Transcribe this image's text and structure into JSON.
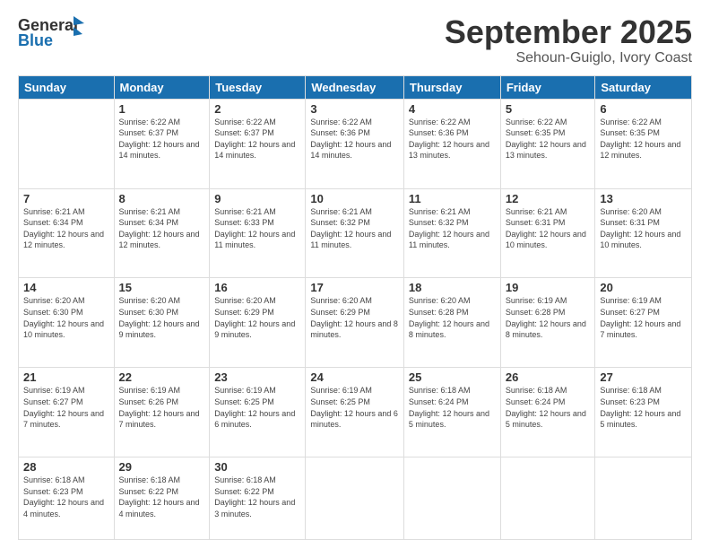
{
  "header": {
    "logo_general": "General",
    "logo_blue": "Blue",
    "month": "September 2025",
    "location": "Sehoun-Guiglo, Ivory Coast"
  },
  "columns": [
    "Sunday",
    "Monday",
    "Tuesday",
    "Wednesday",
    "Thursday",
    "Friday",
    "Saturday"
  ],
  "weeks": [
    [
      {
        "day": "",
        "sunrise": "",
        "sunset": "",
        "daylight": ""
      },
      {
        "day": "1",
        "sunrise": "Sunrise: 6:22 AM",
        "sunset": "Sunset: 6:37 PM",
        "daylight": "Daylight: 12 hours and 14 minutes."
      },
      {
        "day": "2",
        "sunrise": "Sunrise: 6:22 AM",
        "sunset": "Sunset: 6:37 PM",
        "daylight": "Daylight: 12 hours and 14 minutes."
      },
      {
        "day": "3",
        "sunrise": "Sunrise: 6:22 AM",
        "sunset": "Sunset: 6:36 PM",
        "daylight": "Daylight: 12 hours and 14 minutes."
      },
      {
        "day": "4",
        "sunrise": "Sunrise: 6:22 AM",
        "sunset": "Sunset: 6:36 PM",
        "daylight": "Daylight: 12 hours and 13 minutes."
      },
      {
        "day": "5",
        "sunrise": "Sunrise: 6:22 AM",
        "sunset": "Sunset: 6:35 PM",
        "daylight": "Daylight: 12 hours and 13 minutes."
      },
      {
        "day": "6",
        "sunrise": "Sunrise: 6:22 AM",
        "sunset": "Sunset: 6:35 PM",
        "daylight": "Daylight: 12 hours and 12 minutes."
      }
    ],
    [
      {
        "day": "7",
        "sunrise": "Sunrise: 6:21 AM",
        "sunset": "Sunset: 6:34 PM",
        "daylight": "Daylight: 12 hours and 12 minutes."
      },
      {
        "day": "8",
        "sunrise": "Sunrise: 6:21 AM",
        "sunset": "Sunset: 6:34 PM",
        "daylight": "Daylight: 12 hours and 12 minutes."
      },
      {
        "day": "9",
        "sunrise": "Sunrise: 6:21 AM",
        "sunset": "Sunset: 6:33 PM",
        "daylight": "Daylight: 12 hours and 11 minutes."
      },
      {
        "day": "10",
        "sunrise": "Sunrise: 6:21 AM",
        "sunset": "Sunset: 6:32 PM",
        "daylight": "Daylight: 12 hours and 11 minutes."
      },
      {
        "day": "11",
        "sunrise": "Sunrise: 6:21 AM",
        "sunset": "Sunset: 6:32 PM",
        "daylight": "Daylight: 12 hours and 11 minutes."
      },
      {
        "day": "12",
        "sunrise": "Sunrise: 6:21 AM",
        "sunset": "Sunset: 6:31 PM",
        "daylight": "Daylight: 12 hours and 10 minutes."
      },
      {
        "day": "13",
        "sunrise": "Sunrise: 6:20 AM",
        "sunset": "Sunset: 6:31 PM",
        "daylight": "Daylight: 12 hours and 10 minutes."
      }
    ],
    [
      {
        "day": "14",
        "sunrise": "Sunrise: 6:20 AM",
        "sunset": "Sunset: 6:30 PM",
        "daylight": "Daylight: 12 hours and 10 minutes."
      },
      {
        "day": "15",
        "sunrise": "Sunrise: 6:20 AM",
        "sunset": "Sunset: 6:30 PM",
        "daylight": "Daylight: 12 hours and 9 minutes."
      },
      {
        "day": "16",
        "sunrise": "Sunrise: 6:20 AM",
        "sunset": "Sunset: 6:29 PM",
        "daylight": "Daylight: 12 hours and 9 minutes."
      },
      {
        "day": "17",
        "sunrise": "Sunrise: 6:20 AM",
        "sunset": "Sunset: 6:29 PM",
        "daylight": "Daylight: 12 hours and 8 minutes."
      },
      {
        "day": "18",
        "sunrise": "Sunrise: 6:20 AM",
        "sunset": "Sunset: 6:28 PM",
        "daylight": "Daylight: 12 hours and 8 minutes."
      },
      {
        "day": "19",
        "sunrise": "Sunrise: 6:19 AM",
        "sunset": "Sunset: 6:28 PM",
        "daylight": "Daylight: 12 hours and 8 minutes."
      },
      {
        "day": "20",
        "sunrise": "Sunrise: 6:19 AM",
        "sunset": "Sunset: 6:27 PM",
        "daylight": "Daylight: 12 hours and 7 minutes."
      }
    ],
    [
      {
        "day": "21",
        "sunrise": "Sunrise: 6:19 AM",
        "sunset": "Sunset: 6:27 PM",
        "daylight": "Daylight: 12 hours and 7 minutes."
      },
      {
        "day": "22",
        "sunrise": "Sunrise: 6:19 AM",
        "sunset": "Sunset: 6:26 PM",
        "daylight": "Daylight: 12 hours and 7 minutes."
      },
      {
        "day": "23",
        "sunrise": "Sunrise: 6:19 AM",
        "sunset": "Sunset: 6:25 PM",
        "daylight": "Daylight: 12 hours and 6 minutes."
      },
      {
        "day": "24",
        "sunrise": "Sunrise: 6:19 AM",
        "sunset": "Sunset: 6:25 PM",
        "daylight": "Daylight: 12 hours and 6 minutes."
      },
      {
        "day": "25",
        "sunrise": "Sunrise: 6:18 AM",
        "sunset": "Sunset: 6:24 PM",
        "daylight": "Daylight: 12 hours and 5 minutes."
      },
      {
        "day": "26",
        "sunrise": "Sunrise: 6:18 AM",
        "sunset": "Sunset: 6:24 PM",
        "daylight": "Daylight: 12 hours and 5 minutes."
      },
      {
        "day": "27",
        "sunrise": "Sunrise: 6:18 AM",
        "sunset": "Sunset: 6:23 PM",
        "daylight": "Daylight: 12 hours and 5 minutes."
      }
    ],
    [
      {
        "day": "28",
        "sunrise": "Sunrise: 6:18 AM",
        "sunset": "Sunset: 6:23 PM",
        "daylight": "Daylight: 12 hours and 4 minutes."
      },
      {
        "day": "29",
        "sunrise": "Sunrise: 6:18 AM",
        "sunset": "Sunset: 6:22 PM",
        "daylight": "Daylight: 12 hours and 4 minutes."
      },
      {
        "day": "30",
        "sunrise": "Sunrise: 6:18 AM",
        "sunset": "Sunset: 6:22 PM",
        "daylight": "Daylight: 12 hours and 3 minutes."
      },
      {
        "day": "",
        "sunrise": "",
        "sunset": "",
        "daylight": ""
      },
      {
        "day": "",
        "sunrise": "",
        "sunset": "",
        "daylight": ""
      },
      {
        "day": "",
        "sunrise": "",
        "sunset": "",
        "daylight": ""
      },
      {
        "day": "",
        "sunrise": "",
        "sunset": "",
        "daylight": ""
      }
    ]
  ]
}
